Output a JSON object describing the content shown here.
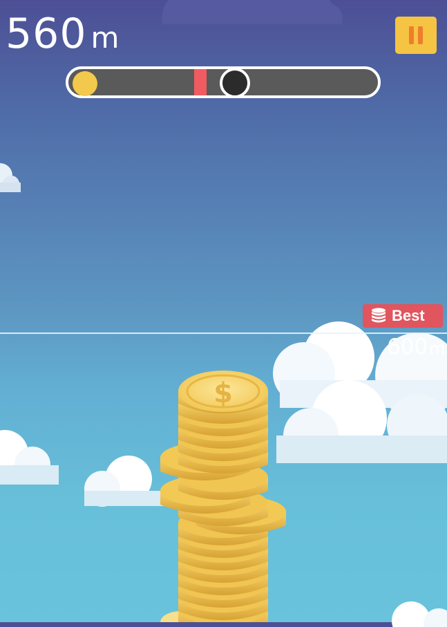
{
  "hud": {
    "distance_value": "560",
    "distance_unit": "m",
    "pause_icon": "pause-icon",
    "progress": {
      "icon_start": "coin-icon",
      "current_fraction": 0.52,
      "best_fraction": 0.42
    }
  },
  "best": {
    "label": "Best",
    "icon": "coin-stack-icon",
    "distance_value": "600",
    "distance_unit": "m"
  },
  "tower": {
    "icon": "dollar-coin-icon",
    "stacked_coins": 20
  },
  "colors": {
    "accent_yellow": "#f5c443",
    "pause_glyph": "#ef7d2b",
    "best_red": "#e0555e",
    "progress_track": "#5a5a5a",
    "coin_gold": "#f2c94c"
  }
}
